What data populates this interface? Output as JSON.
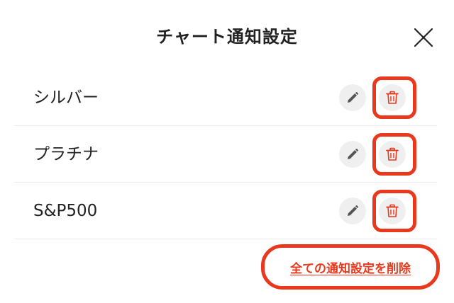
{
  "dialog": {
    "title": "チャート通知設定",
    "close_icon": "close-icon"
  },
  "alerts": [
    {
      "label": "シルバー",
      "edit_icon": "pencil-icon",
      "delete_icon": "trash-icon"
    },
    {
      "label": "プラチナ",
      "edit_icon": "pencil-icon",
      "delete_icon": "trash-icon"
    },
    {
      "label": "S&P500",
      "edit_icon": "pencil-icon",
      "delete_icon": "trash-icon"
    }
  ],
  "footer": {
    "delete_all_label": "全ての通知設定を削除"
  },
  "colors": {
    "accent_red": "#e8391e",
    "icon_bg": "#efefef",
    "text": "#222222"
  }
}
